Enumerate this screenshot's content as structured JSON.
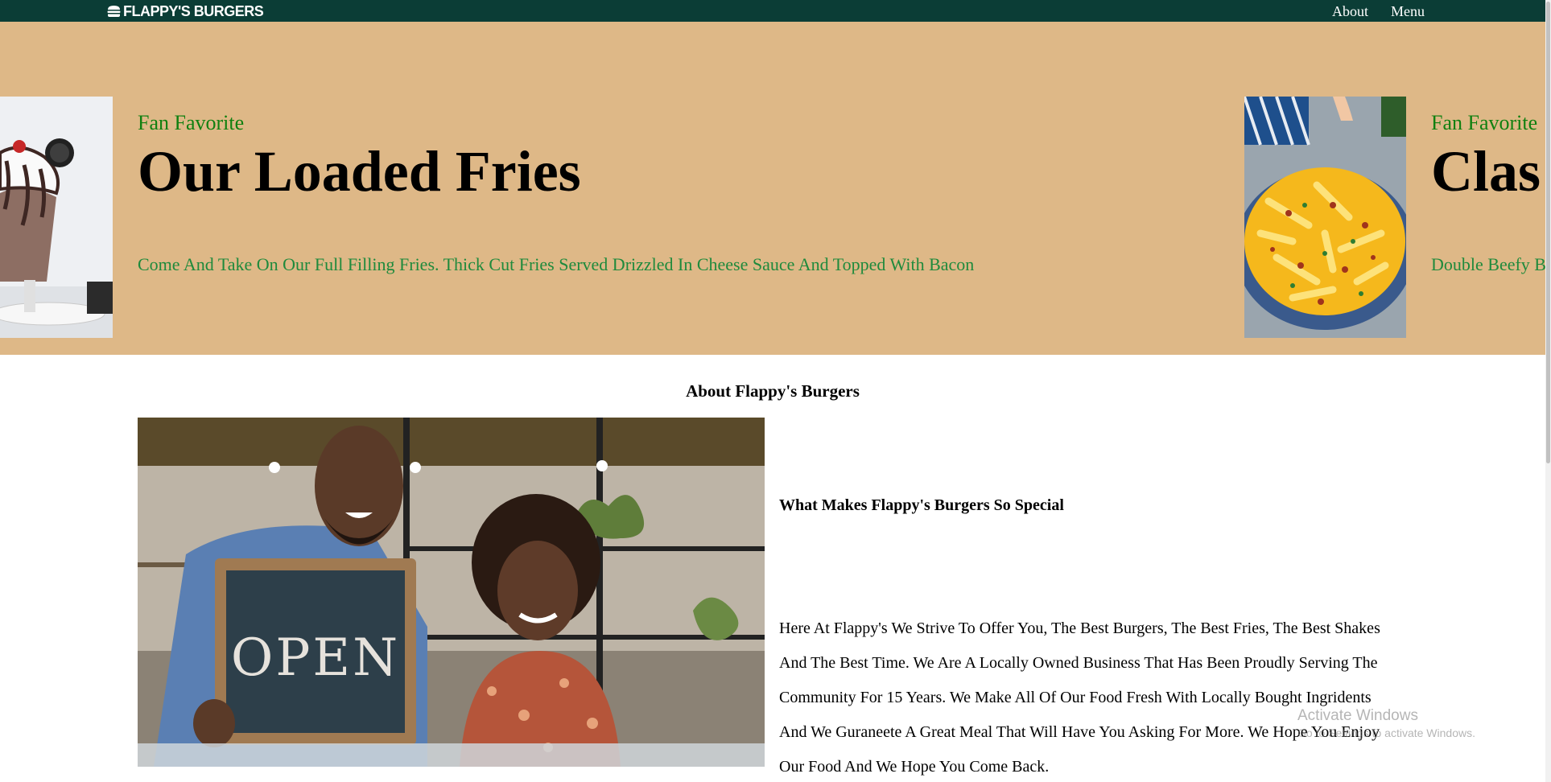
{
  "navbar": {
    "brand": "FLAPPY'S BURGERS",
    "brand_icon": "burger-icon",
    "links": [
      "About",
      "Menu"
    ]
  },
  "hero": {
    "slides": [
      {
        "eyebrow": "Fan Favorite",
        "headline": "Our Loaded Fries",
        "description": "Come And Take On Our Full Filling Fries. Thick Cut Fries Served Drizzled In Cheese Sauce And Topped With Bacon",
        "image": "milkshake-photo"
      },
      {
        "eyebrow": "Fan Favorite",
        "headline": "Clas",
        "description": "Double Beefy B",
        "image": "loaded-fries-photo"
      }
    ]
  },
  "about": {
    "title": "About Flappy's Burgers",
    "photo": "owners-open-sign-photo",
    "photo_sign_text": "OPEN",
    "subtitle": "What Makes Flappy's Burgers So Special",
    "body": "Here At Flappy's We Strive To Offer You, The Best Burgers, The Best Fries, The Best Shakes And The Best Time. We Are A Locally Owned Business That Has Been Proudly Serving The Community For 15 Years. We Make All Of Our Food Fresh With Locally Bought Ingridents And We Guraneete A Great Meal That Will Have You Asking For More. We Hope You Enjoy Our Food And We Hope You Come Back."
  },
  "watermark": {
    "title": "Activate Windows",
    "subtitle": "Go to Settings to activate Windows."
  },
  "colors": {
    "navbar": "#0b3d36",
    "hero_bg": "#deb887",
    "eyebrow": "#108010",
    "description": "#1f8a3c"
  }
}
